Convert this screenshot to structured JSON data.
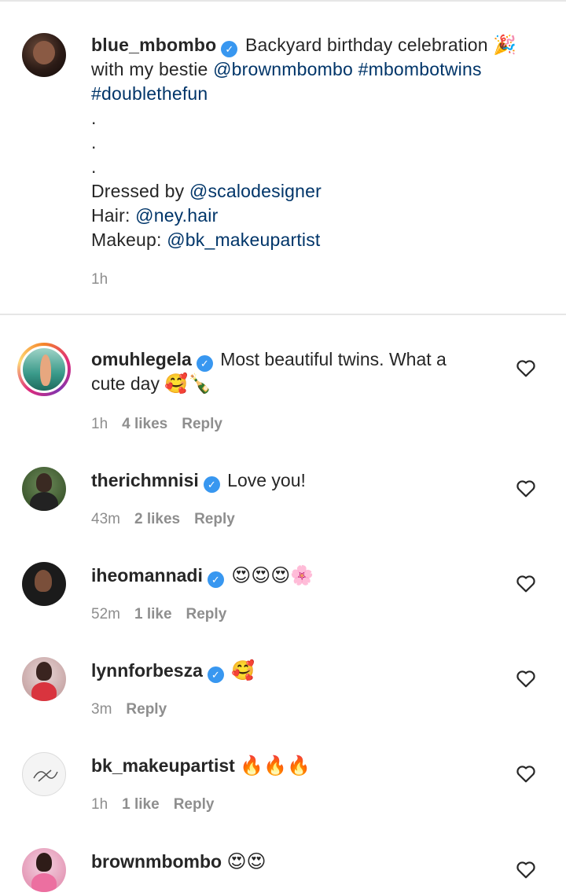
{
  "caption": {
    "username": "blue_mbombo",
    "text_start": "Backyard birthday celebration",
    "text_emoji": "🎉",
    "line2_prefix": "with my bestie ",
    "mention1": "@brownmbombo",
    "hashtag1": "#mbombotwins",
    "hashtag2": "#doublethefun",
    "dots": [
      ".",
      ".",
      "."
    ],
    "dressed_label": "Dressed by ",
    "dressed_mention": "@scalodesigner",
    "hair_label": "Hair: ",
    "hair_mention": "@ney.hair",
    "makeup_label": "Makeup: ",
    "makeup_mention": "@bk_makeupartist",
    "time": "1h"
  },
  "comments": [
    {
      "username": "omuhlegela",
      "verified": true,
      "text_line1": "Most beautiful twins. What a",
      "text_line2": "cute day",
      "emojis": "🥰🍾",
      "time": "1h",
      "likes": "4 likes",
      "reply": "Reply"
    },
    {
      "username": "therichmnisi",
      "verified": true,
      "text": "Love you!",
      "time": "43m",
      "likes": "2 likes",
      "reply": "Reply"
    },
    {
      "username": "iheomannadi",
      "verified": true,
      "emojis": "😍😍😍🌸",
      "time": "52m",
      "likes": "1 like",
      "reply": "Reply"
    },
    {
      "username": "lynnforbesza",
      "verified": true,
      "emojis": "🥰",
      "time": "3m",
      "reply": "Reply"
    },
    {
      "username": "bk_makeupartist",
      "verified": false,
      "emojis": "🔥🔥🔥",
      "time": "1h",
      "likes": "1 like",
      "reply": "Reply"
    },
    {
      "username": "brownmbombo",
      "verified": false,
      "emojis": "😍😍"
    }
  ],
  "icons": {
    "verified": "verified-badge-icon",
    "heart": "heart-outline-icon"
  },
  "colors": {
    "link": "#003569",
    "verified": "#3897f0",
    "meta": "#8e8e8e"
  }
}
